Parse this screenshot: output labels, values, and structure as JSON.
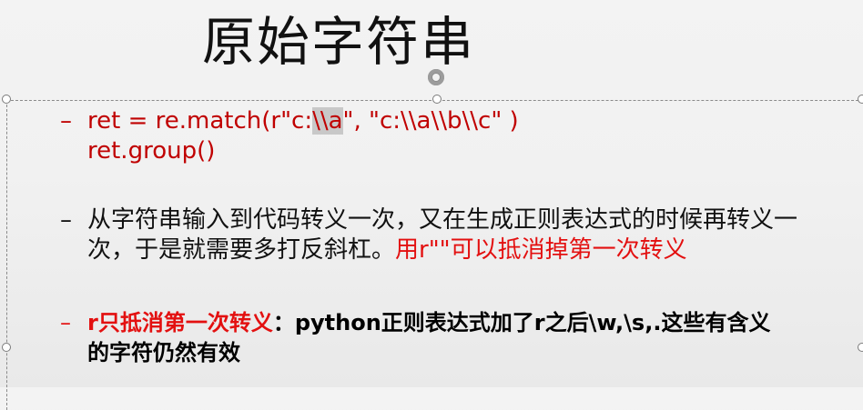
{
  "slide": {
    "title": "原始字符串",
    "bullets": [
      {
        "dash": "–",
        "line1_before": "ret = re.match(r\"c:",
        "line1_highlight": "\\\\a",
        "line1_after": "\", \"c:\\\\a\\\\b\\\\c\" )",
        "line2": "ret.group()"
      },
      {
        "dash": "–",
        "line1": "从字符串输入到代码转义一次，又在生成正则表达式的时候再转义一",
        "line2_black": "次，于是就需要多打反斜杠。",
        "line2_red": "用r\"\"可以抵消掉第一次转义"
      },
      {
        "dash": "–",
        "line1_red": "r只抵消第一次转义",
        "line1_black": "：python正则表达式加了r之后\\w,\\s,.这些有含义",
        "line2": "的字符仍然有效"
      }
    ]
  },
  "colors": {
    "accent_red": "#c00000",
    "highlight_red": "#e31010",
    "text": "#111111",
    "selection_highlight": "#c8c8c8"
  },
  "icons": {
    "rotate": "rotate-handle-icon",
    "resize": "resize-handle-icon"
  }
}
